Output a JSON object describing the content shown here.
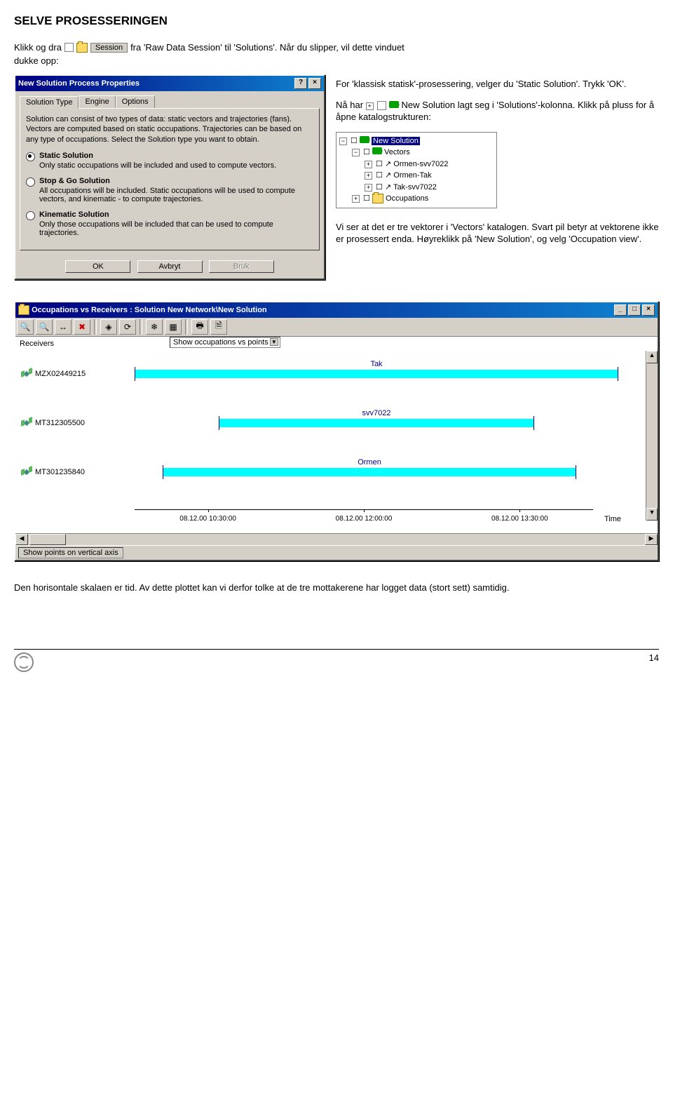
{
  "heading": "SELVE PROSESSERINGEN",
  "intro": {
    "p1a": "Klikk og dra",
    "session_label": "Session",
    "p1b": "fra 'Raw Data Session' til 'Solutions'. Når du slipper, vil dette vinduet",
    "p2": "dukke opp:"
  },
  "dialog": {
    "title": "New Solution Process Properties",
    "tabs": [
      "Solution Type",
      "Engine",
      "Options"
    ],
    "description": "Solution can consist of two types of data: static vectors and trajectories (fans). Vectors are computed based on static occupations. Trajectories can be based on any type of occupations. Select the Solution type you want to obtain.",
    "options": [
      {
        "label": "Static Solution",
        "desc": "Only static occupations will be included and used to compute vectors.",
        "checked": true
      },
      {
        "label": "Stop & Go Solution",
        "desc": "All occupations will be included. Static occupations will be used to compute vectors, and kinematic - to compute trajectories.",
        "checked": false
      },
      {
        "label": "Kinematic Solution",
        "desc": "Only those occupations will be included that can be used to compute trajectories.",
        "checked": false
      }
    ],
    "buttons": {
      "ok": "OK",
      "cancel": "Avbryt",
      "apply": "Bruk"
    }
  },
  "right": {
    "p1": "For 'klassisk statisk'-prosessering, velger du 'Static Solution'. Trykk 'OK'.",
    "p2a": "Nå har",
    "new_sol_label": "New Solution",
    "p2b": "lagt seg i 'Solutions'-kolonna. Klikk på pluss for å åpne katalogstrukturen:",
    "p3": "Vi ser at det er tre vektorer i 'Vectors' katalogen. Svart pil betyr at vektorene ikke er prosessert enda. Høyreklikk på 'New Solution', og velg 'Occupation view'."
  },
  "tree": {
    "root": "New Solution",
    "vectors_label": "Vectors",
    "vectors": [
      "Ormen-svv7022",
      "Ormen-Tak",
      "Tak-svv7022"
    ],
    "occupations": "Occupations"
  },
  "occ": {
    "title": "Occupations vs Receivers : Solution New Network\\New Solution",
    "dropdown": "Show occupations vs points",
    "receivers_label": "Receivers",
    "lanes": [
      {
        "receiver": "MZX02449215",
        "bar_label": "Tak"
      },
      {
        "receiver": "MT312305500",
        "bar_label": "svv7022"
      },
      {
        "receiver": "MT301235840",
        "bar_label": "Ormen"
      }
    ],
    "time_ticks": [
      "08.12.00 10:30:00",
      "08.12.00 12:00:00",
      "08.12.00 13:30:00"
    ],
    "time_label": "Time",
    "status": "Show points on vertical axis"
  },
  "chart_data": {
    "type": "bar",
    "title": "Occupations vs Receivers",
    "xlabel": "Time",
    "ylabel": "Receivers",
    "categories": [
      "MZX02449215",
      "MT312305500",
      "MT301235840"
    ],
    "series": [
      {
        "name": "Tak",
        "receiver": "MZX02449215",
        "start": "08.12.00 09:40",
        "end": "08.12.00 14:30"
      },
      {
        "name": "svv7022",
        "receiver": "MT312305500",
        "start": "08.12.00 10:40",
        "end": "08.12.00 13:40"
      },
      {
        "name": "Ormen",
        "receiver": "MT301235840",
        "start": "08.12.00 10:00",
        "end": "08.12.00 14:00"
      }
    ],
    "xlim": [
      "08.12.00 09:30",
      "08.12.00 14:30"
    ]
  },
  "bottom": "Den horisontale skalaen er tid. Av dette plottet kan vi derfor tolke at de tre mottakerene har logget data (stort sett) samtidig.",
  "page_number": "14"
}
